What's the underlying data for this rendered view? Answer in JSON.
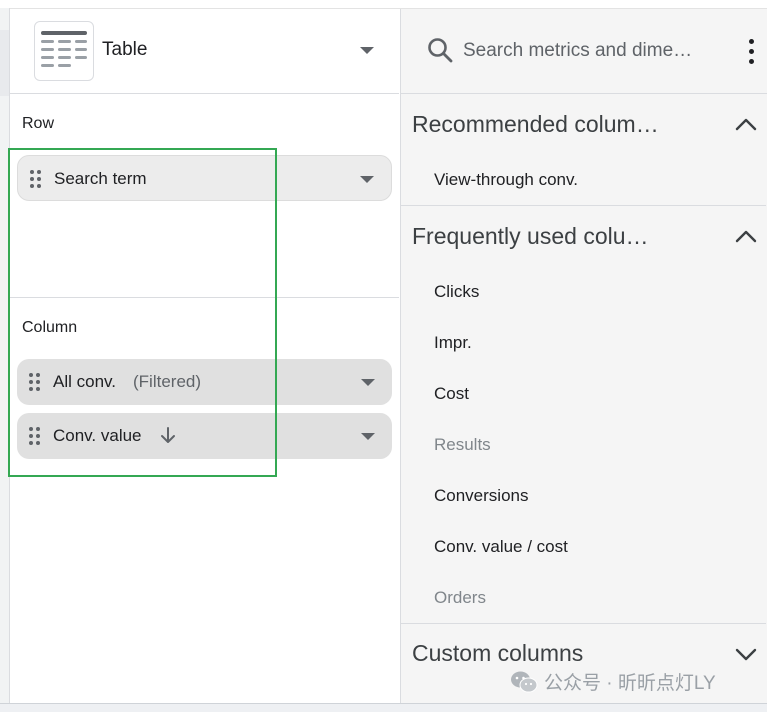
{
  "visualization": {
    "type_label": "Table",
    "thumbnail_icon": "table-thumbnail-icon"
  },
  "rows_section": {
    "label": "Row",
    "chips": [
      {
        "label": "Search term"
      }
    ]
  },
  "columns_section": {
    "label": "Column",
    "chips": [
      {
        "label": "All conv.",
        "sub": "(Filtered)"
      },
      {
        "label": "Conv. value",
        "sort_icon": "arrow-down-icon"
      }
    ]
  },
  "search": {
    "placeholder": "Search metrics and dime…"
  },
  "groups": [
    {
      "title": "Recommended colum…",
      "expanded": true,
      "items": [
        {
          "label": "View-through conv.",
          "enabled": true
        }
      ]
    },
    {
      "title": "Frequently used colu…",
      "expanded": true,
      "items": [
        {
          "label": "Clicks",
          "enabled": true
        },
        {
          "label": "Impr.",
          "enabled": true
        },
        {
          "label": "Cost",
          "enabled": true
        },
        {
          "label": "Results",
          "enabled": false
        },
        {
          "label": "Conversions",
          "enabled": true
        },
        {
          "label": "Conv. value / cost",
          "enabled": true
        },
        {
          "label": "Orders",
          "enabled": false
        }
      ]
    },
    {
      "title": "Custom columns",
      "expanded": false,
      "items": []
    }
  ],
  "watermark": {
    "text": "公众号 · 昕昕点灯LY"
  },
  "colors": {
    "highlight": "#34a853",
    "panel_bg": "#f5f5f5",
    "chip_bg": "#e0e0e0"
  }
}
